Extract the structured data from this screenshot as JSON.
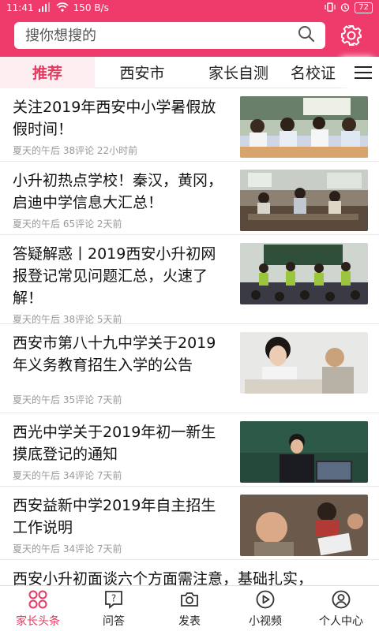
{
  "status": {
    "time": "11:41",
    "net": "150 B/s",
    "battery": "72"
  },
  "search": {
    "placeholder": "搜你想搜的"
  },
  "tabs": [
    {
      "label": "推荐"
    },
    {
      "label": "西安市"
    },
    {
      "label": "家长自测"
    },
    {
      "label": "名校证"
    }
  ],
  "feed": [
    {
      "title": "关注2019年西安中小学暑假放假时间！",
      "meta": "夏天的午后 38评论 22小时前",
      "thumb": "classroom-students-photo"
    },
    {
      "title": "小升初热点学校！秦汉，黄冈，启迪中学信息大汇总！",
      "meta": "夏天的午后 65评论 2天前",
      "thumb": "school-lab-photo"
    },
    {
      "title": "答疑解惑丨2019西安小升初网报登记常见问题汇总，火速了解！",
      "meta": "夏天的午后 38评论 5天前",
      "thumb": "classroom-volunteers-photo"
    },
    {
      "title": "西安市第八十九中学关于2019年义务教育招生入学的公告",
      "meta": "夏天的午后 35评论 7天前",
      "thumb": "student-thinking-photo"
    },
    {
      "title": "西光中学关于2019年初一新生摸底登记的通知",
      "meta": "夏天的午后 34评论 7天前",
      "thumb": "teacher-laptop-photo"
    },
    {
      "title": "西安益新中学2019年自主招生工作说明",
      "meta": "夏天的午后 34评论 7天前",
      "thumb": "children-crying-photo"
    },
    {
      "title": "西安小升初面谈六个方面需注意，基础扎实，",
      "meta": "",
      "thumb": ""
    }
  ],
  "nav": [
    {
      "label": "家长头条",
      "icon": "grid-icon"
    },
    {
      "label": "问答",
      "icon": "question-icon"
    },
    {
      "label": "发表",
      "icon": "camera-icon"
    },
    {
      "label": "小视频",
      "icon": "play-icon"
    },
    {
      "label": "个人中心",
      "icon": "person-icon"
    }
  ],
  "colors": {
    "brand": "#ee3b6b",
    "accent": "#e8385f"
  }
}
